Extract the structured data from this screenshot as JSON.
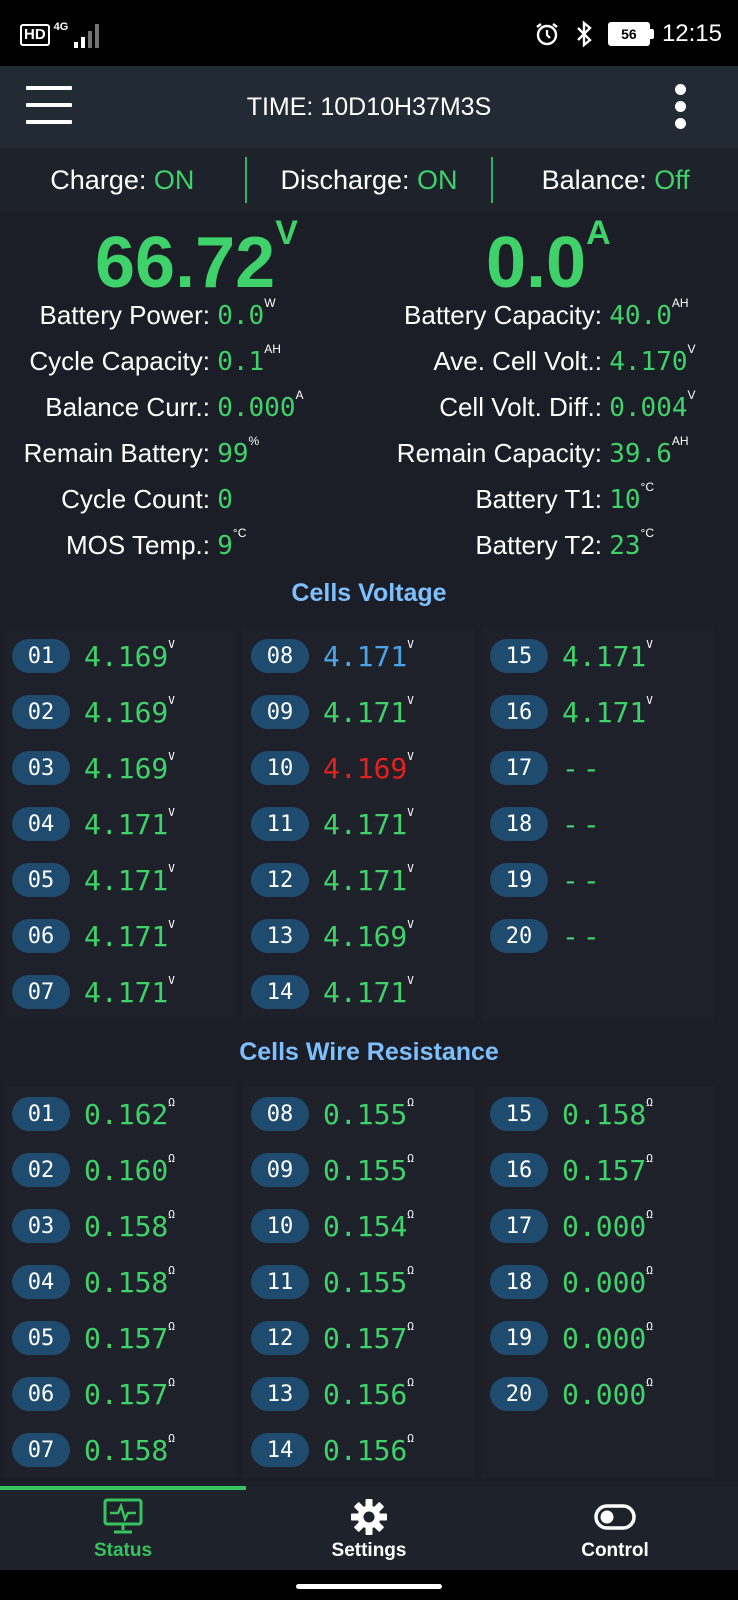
{
  "statusbar": {
    "hd": "HD",
    "network": "4G",
    "battery_level": "56",
    "clock": "12:15",
    "icons": [
      "signal-icon",
      "alarm-icon",
      "bluetooth-icon",
      "battery-icon"
    ]
  },
  "appbar": {
    "title": "TIME: 10D10H37M3S"
  },
  "switches": {
    "charge_label": "Charge: ",
    "charge_value": "ON",
    "discharge_label": "Discharge: ",
    "discharge_value": "ON",
    "balance_label": "Balance: ",
    "balance_value": "Off"
  },
  "summary": {
    "voltage": "66.72",
    "voltage_unit": "V",
    "current": "0.0",
    "current_unit": "A"
  },
  "stats_left": [
    {
      "label": "Battery Power:",
      "value": "0.0",
      "unit": "W"
    },
    {
      "label": "Cycle Capacity:",
      "value": "0.1",
      "unit": "AH"
    },
    {
      "label": "Balance Curr.:",
      "value": "0.000",
      "unit": "A"
    },
    {
      "label": "Remain Battery:",
      "value": "99",
      "unit": "%"
    },
    {
      "label": "Cycle Count:",
      "value": "0",
      "unit": ""
    },
    {
      "label": "MOS Temp.:",
      "value": "9",
      "unit": "°C"
    }
  ],
  "stats_right": [
    {
      "label": "Battery Capacity:",
      "value": "40.0",
      "unit": "AH"
    },
    {
      "label": "Ave. Cell Volt.:",
      "value": "4.170",
      "unit": "V"
    },
    {
      "label": "Cell Volt. Diff.:",
      "value": "0.004",
      "unit": "V"
    },
    {
      "label": "Remain Capacity:",
      "value": "39.6",
      "unit": "AH"
    },
    {
      "label": "Battery T1:",
      "value": "10",
      "unit": "°C"
    },
    {
      "label": "Battery T2:",
      "value": "23",
      "unit": "°C"
    }
  ],
  "cells_voltage": {
    "title": "Cells Voltage",
    "unit": "V",
    "cells": [
      {
        "num": "01",
        "value": "4.169",
        "status": "normal"
      },
      {
        "num": "02",
        "value": "4.169",
        "status": "normal"
      },
      {
        "num": "03",
        "value": "4.169",
        "status": "normal"
      },
      {
        "num": "04",
        "value": "4.171",
        "status": "normal"
      },
      {
        "num": "05",
        "value": "4.171",
        "status": "normal"
      },
      {
        "num": "06",
        "value": "4.171",
        "status": "normal"
      },
      {
        "num": "07",
        "value": "4.171",
        "status": "normal"
      },
      {
        "num": "08",
        "value": "4.171",
        "status": "max"
      },
      {
        "num": "09",
        "value": "4.171",
        "status": "normal"
      },
      {
        "num": "10",
        "value": "4.169",
        "status": "min"
      },
      {
        "num": "11",
        "value": "4.171",
        "status": "normal"
      },
      {
        "num": "12",
        "value": "4.171",
        "status": "normal"
      },
      {
        "num": "13",
        "value": "4.169",
        "status": "normal"
      },
      {
        "num": "14",
        "value": "4.171",
        "status": "normal"
      },
      {
        "num": "15",
        "value": "4.171",
        "status": "normal"
      },
      {
        "num": "16",
        "value": "4.171",
        "status": "normal"
      },
      {
        "num": "17",
        "value": "--",
        "status": "empty"
      },
      {
        "num": "18",
        "value": "--",
        "status": "empty"
      },
      {
        "num": "19",
        "value": "--",
        "status": "empty"
      },
      {
        "num": "20",
        "value": "--",
        "status": "empty"
      }
    ]
  },
  "wire_resistance": {
    "title": "Cells Wire Resistance",
    "unit": "Ω",
    "cells": [
      {
        "num": "01",
        "value": "0.162"
      },
      {
        "num": "02",
        "value": "0.160"
      },
      {
        "num": "03",
        "value": "0.158"
      },
      {
        "num": "04",
        "value": "0.158"
      },
      {
        "num": "05",
        "value": "0.157"
      },
      {
        "num": "06",
        "value": "0.157"
      },
      {
        "num": "07",
        "value": "0.158"
      },
      {
        "num": "08",
        "value": "0.155"
      },
      {
        "num": "09",
        "value": "0.155"
      },
      {
        "num": "10",
        "value": "0.154"
      },
      {
        "num": "11",
        "value": "0.155"
      },
      {
        "num": "12",
        "value": "0.157"
      },
      {
        "num": "13",
        "value": "0.156"
      },
      {
        "num": "14",
        "value": "0.156"
      },
      {
        "num": "15",
        "value": "0.158"
      },
      {
        "num": "16",
        "value": "0.157"
      },
      {
        "num": "17",
        "value": "0.000"
      },
      {
        "num": "18",
        "value": "0.000"
      },
      {
        "num": "19",
        "value": "0.000"
      },
      {
        "num": "20",
        "value": "0.000"
      }
    ]
  },
  "nav": {
    "items": [
      {
        "label": "Status",
        "icon": "monitor-pulse-icon",
        "active": true
      },
      {
        "label": "Settings",
        "icon": "gear-icon",
        "active": false
      },
      {
        "label": "Control",
        "icon": "toggle-icon",
        "active": false
      }
    ]
  },
  "colors": {
    "accent_green": "#3fd16a",
    "max_blue": "#4aa3e6",
    "min_red": "#e32020",
    "section_title": "#7ec0ff",
    "badge": "#1f4c6e"
  }
}
